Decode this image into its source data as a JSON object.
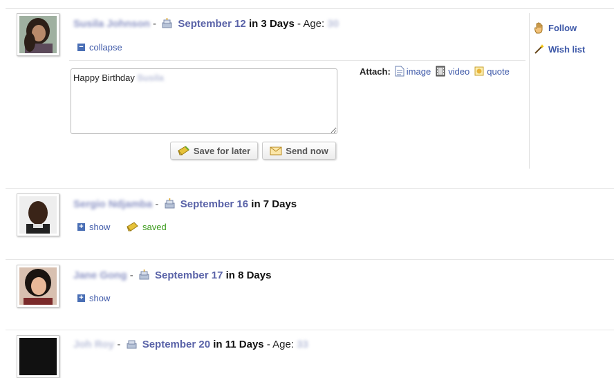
{
  "entries": [
    {
      "name": "Susila Johnson",
      "date": "September 12",
      "in_days": "in 3 Days",
      "age_label": "- Age:",
      "age": "30",
      "toggle_label": "collapse",
      "message_prefix": "Happy Birthday",
      "message_name": "Susila",
      "attach_label": "Attach:",
      "attach_image": "image",
      "attach_video": "video",
      "attach_quote": "quote",
      "save_label": "Save for later",
      "send_label": "Send now",
      "follow_label": "Follow",
      "wishlist_label": "Wish list"
    },
    {
      "name": "Sergio Ndjamba",
      "date": "September 16",
      "in_days": "in 7 Days",
      "toggle_label": "show",
      "saved_label": "saved"
    },
    {
      "name": "Jane Gong",
      "date": "September 17",
      "in_days": "in 8 Days",
      "toggle_label": "show"
    },
    {
      "name": "Joh Roy",
      "date": "September 20",
      "in_days": "in 11 Days",
      "age_label": "- Age:",
      "age": "33"
    }
  ],
  "separator": "-",
  "colors": {
    "date": "#5a63a8",
    "link": "#3d58a8",
    "saved": "#3a9a1a",
    "blurred_name": "#8b93c4"
  },
  "icons": {
    "cake": "cake-icon",
    "expand": "plus-square-icon",
    "collapse": "minus-square-icon",
    "follow": "hand-icon",
    "wishlist": "wand-icon",
    "save": "pencil-icon",
    "send": "envelope-icon"
  }
}
